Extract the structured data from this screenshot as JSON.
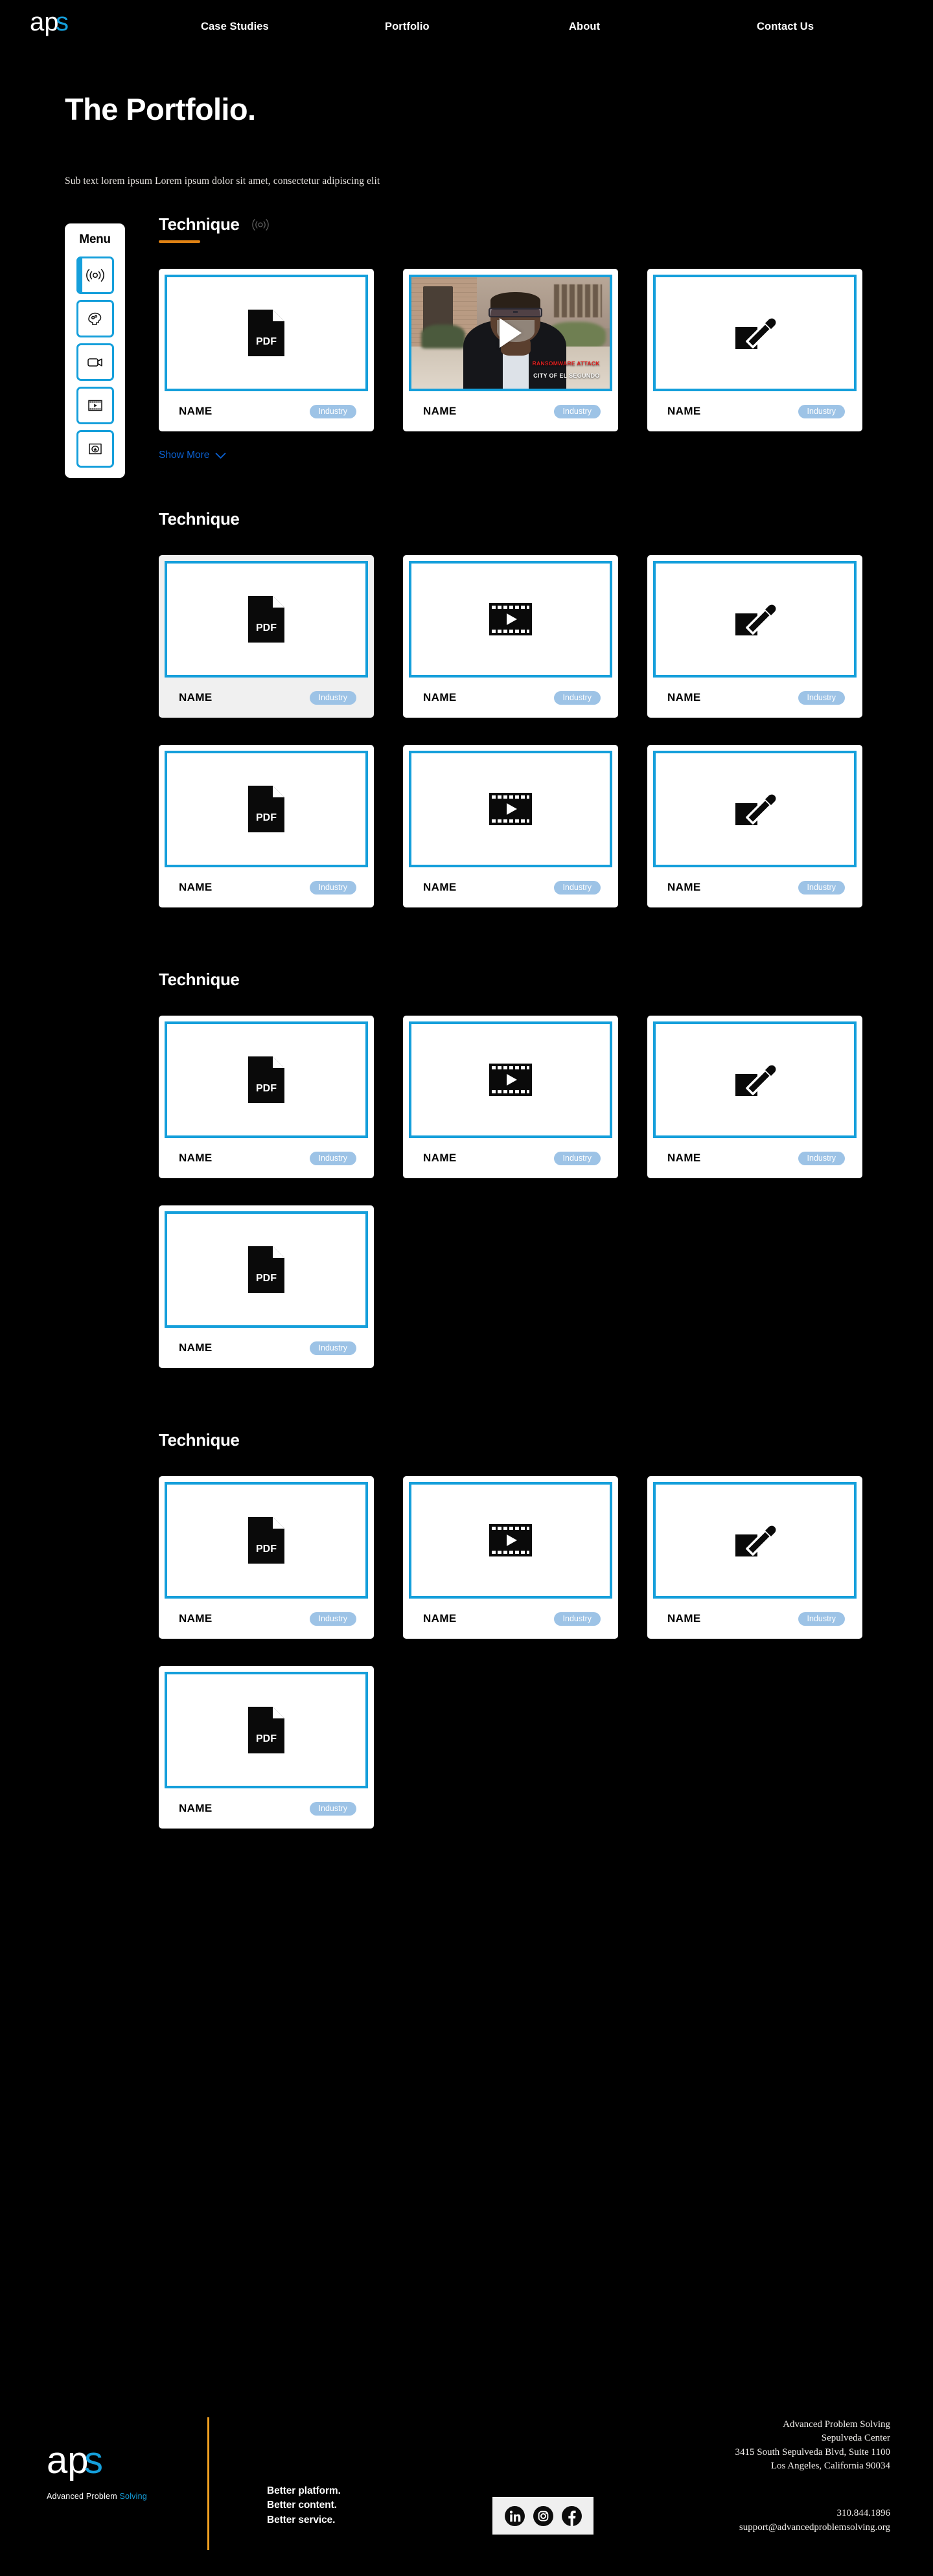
{
  "brand": {
    "logo_text": "aps",
    "logo_accent_color": "#159fdb",
    "footer_tagline_a": "Advanced Problem ",
    "footer_tagline_b": "Solving"
  },
  "nav": {
    "items": [
      {
        "label": "Case Studies"
      },
      {
        "label": "Portfolio"
      },
      {
        "label": "About"
      },
      {
        "label": "Contact Us"
      }
    ]
  },
  "hero": {
    "title": "The Portfolio.",
    "subtext": "Sub text lorem ipsum Lorem ipsum dolor sit amet, consectetur adipiscing elit"
  },
  "menu": {
    "title": "Menu",
    "items": [
      {
        "icon": "broadcast-icon",
        "active": true
      },
      {
        "icon": "brain-head-icon",
        "active": false
      },
      {
        "icon": "video-camera-icon",
        "active": false
      },
      {
        "icon": "film-play-icon",
        "active": false
      },
      {
        "icon": "sticker-star-icon",
        "active": false
      }
    ]
  },
  "show_more": {
    "label": "Show More",
    "icon": "chevron-down-icon",
    "color": "#0b63d6"
  },
  "card_defaults": {
    "name": "NAME",
    "chip": "Industry"
  },
  "video_card": {
    "caption_line1": "RANSOMWARE ATTACK",
    "caption_line2": "CITY OF EL SEGUNDO",
    "caption1_color": "#e02020",
    "play_icon": "play-icon"
  },
  "sections": [
    {
      "title": "Technique",
      "icon": "broadcast-icon",
      "has_underline": true,
      "underline_color": "#e08214",
      "has_show_more": true,
      "cards": [
        {
          "thumb": "pdf-icon",
          "name": "NAME",
          "chip": "Industry",
          "hovered": false
        },
        {
          "thumb": "video-thumbnail",
          "name": "NAME",
          "chip": "Industry",
          "hovered": false
        },
        {
          "thumb": "pen-edit-icon",
          "name": "NAME",
          "chip": "Industry",
          "hovered": false
        }
      ]
    },
    {
      "title": "Technique",
      "icon": null,
      "has_underline": false,
      "has_show_more": false,
      "cards": [
        {
          "thumb": "pdf-icon",
          "name": "NAME",
          "chip": "Industry",
          "hovered": true
        },
        {
          "thumb": "film-play-icon",
          "name": "NAME",
          "chip": "Industry",
          "hovered": false
        },
        {
          "thumb": "pen-edit-icon",
          "name": "NAME",
          "chip": "Industry",
          "hovered": false
        },
        {
          "thumb": "pdf-icon",
          "name": "NAME",
          "chip": "Industry",
          "hovered": false
        },
        {
          "thumb": "film-play-icon",
          "name": "NAME",
          "chip": "Industry",
          "hovered": false
        },
        {
          "thumb": "pen-edit-icon",
          "name": "NAME",
          "chip": "Industry",
          "hovered": false
        }
      ]
    },
    {
      "title": "Technique",
      "icon": null,
      "has_underline": false,
      "has_show_more": false,
      "cards": [
        {
          "thumb": "pdf-icon",
          "name": "NAME",
          "chip": "Industry",
          "hovered": false
        },
        {
          "thumb": "film-play-icon",
          "name": "NAME",
          "chip": "Industry",
          "hovered": false
        },
        {
          "thumb": "pen-edit-icon",
          "name": "NAME",
          "chip": "Industry",
          "hovered": false
        },
        {
          "thumb": "pdf-icon",
          "name": "NAME",
          "chip": "Industry",
          "hovered": false
        }
      ]
    },
    {
      "title": "Technique",
      "icon": null,
      "has_underline": false,
      "has_show_more": false,
      "cards": [
        {
          "thumb": "pdf-icon",
          "name": "NAME",
          "chip": "Industry",
          "hovered": false
        },
        {
          "thumb": "film-play-icon",
          "name": "NAME",
          "chip": "Industry",
          "hovered": false
        },
        {
          "thumb": "pen-edit-icon",
          "name": "NAME",
          "chip": "Industry",
          "hovered": false
        },
        {
          "thumb": "pdf-icon",
          "name": "NAME",
          "chip": "Industry",
          "hovered": false
        }
      ]
    }
  ],
  "footer": {
    "slogan_line1": "Better platform.",
    "slogan_line2": "Better content.",
    "slogan_line3": "Better service.",
    "rule_color": "#f0a022",
    "address": [
      "Advanced Problem Solving",
      "Sepulveda Center",
      "3415 South Sepulveda Blvd, Suite 1100",
      "Los Angeles, California 90034"
    ],
    "phone": "310.844.1896",
    "email": "support@advancedproblemsolving.org",
    "social": [
      {
        "name": "linkedin-icon"
      },
      {
        "name": "instagram-icon"
      },
      {
        "name": "facebook-icon"
      }
    ]
  }
}
